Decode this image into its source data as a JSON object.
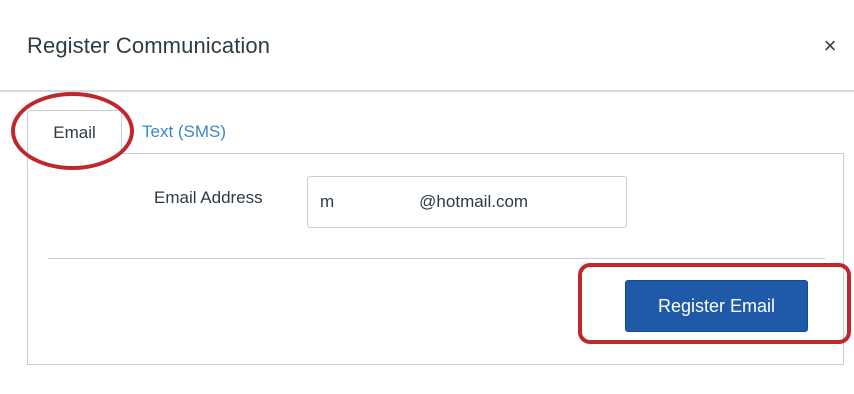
{
  "dialog": {
    "title": "Register Communication",
    "close_glyph": "×",
    "close_icon": "close-icon"
  },
  "tabs": [
    {
      "label": "Email",
      "active": true
    },
    {
      "label": "Text (SMS)",
      "active": false
    }
  ],
  "form": {
    "email_label": "Email Address",
    "email_value": "m                  @hotmail.com",
    "submit_label": "Register Email"
  },
  "colors": {
    "primary_button": "#1f5aa8",
    "link_tab": "#3c87c8",
    "annotation": "#c0272d",
    "text": "#2d3b45"
  }
}
